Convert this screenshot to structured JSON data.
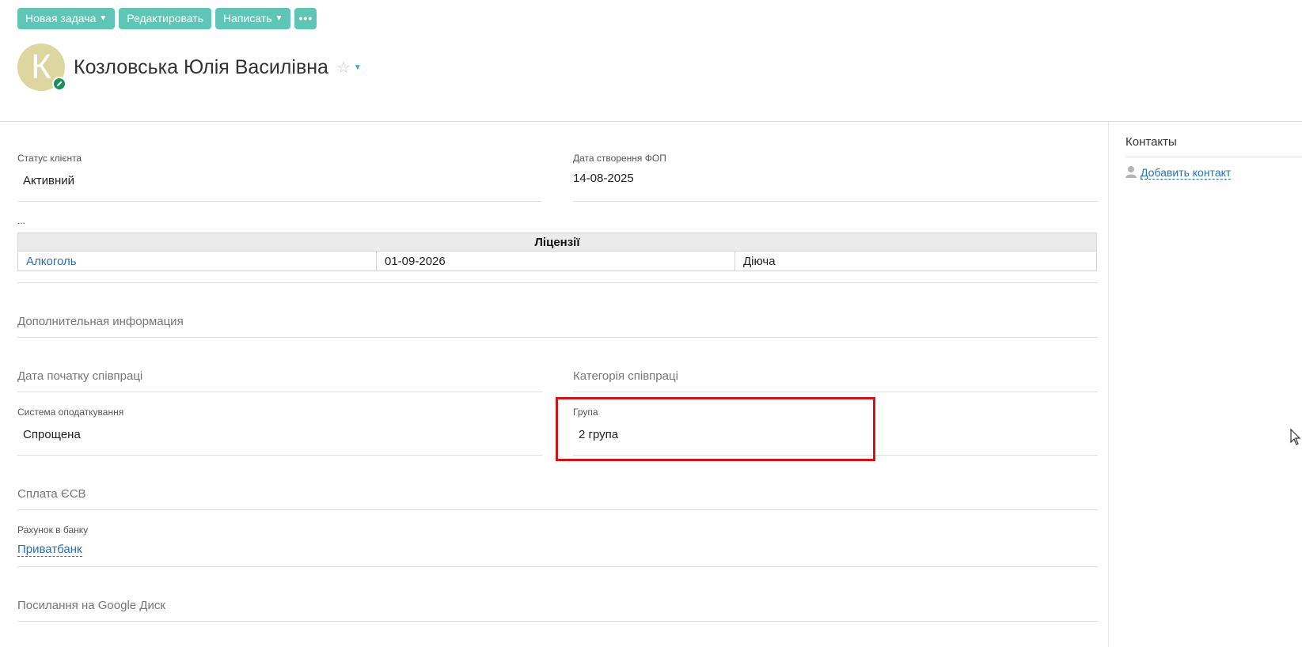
{
  "toolbar": {
    "new_task": "Новая задача",
    "edit": "Редактировать",
    "write": "Написать",
    "more": "•••"
  },
  "header": {
    "avatar_letter": "К",
    "name": "Козловська Юлія Василівна",
    "star_icon": "star-icon"
  },
  "fields": {
    "client_status_label": "Статус клієнта",
    "client_status_value": "Активний",
    "fop_date_label": "Дата створення ФОП",
    "fop_date_value": "14-08-2025",
    "ellipsis": "...",
    "tax_system_label": "Система оподаткування",
    "tax_system_value": "Спрощена",
    "group_label": "Група",
    "group_value": "2 група",
    "bank_label": "Рахунок в банку",
    "bank_value": "Приватбанк"
  },
  "licenses": {
    "title": "Ліцензії",
    "rows": [
      {
        "name": "Алкоголь",
        "date": "01-09-2026",
        "status": "Діюча"
      }
    ]
  },
  "sections": {
    "additional_info": "Дополнительная информация",
    "start_date": "Дата початку співпраці",
    "category": "Категорія співпраці",
    "esv": "Сплата ЄСВ",
    "google_drive": "Посилання на Google Диск"
  },
  "contacts": {
    "title": "Контакты",
    "add": "Добавить контакт"
  },
  "colors": {
    "button": "#5fc6b5",
    "link": "#2b6fb8",
    "highlight": "#d0141c",
    "avatar": "#ddd69e"
  }
}
